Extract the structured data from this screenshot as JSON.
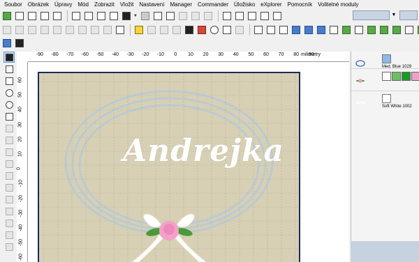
{
  "menu": [
    "Soubor",
    "Obrázek",
    "Úpravy",
    "Mód",
    "Zobrazit",
    "Vložit",
    "Nastavení",
    "Manager",
    "Commander",
    "Úložisko",
    "eXplorer",
    "Pomocník",
    "Volitelné moduly"
  ],
  "ruler": {
    "unit": "milimetry",
    "h_ticks": [
      "-90",
      "-80",
      "-70",
      "-60",
      "-50",
      "-40",
      "-30",
      "-20",
      "-10",
      "0",
      "10",
      "20",
      "30",
      "40",
      "50",
      "60",
      "70",
      "80",
      "90"
    ],
    "v_ticks": [
      "60",
      "50",
      "40",
      "30",
      "20",
      "10",
      "0",
      "-10",
      "-20",
      "-30",
      "-40",
      "-50",
      "-60"
    ]
  },
  "design": {
    "title": "Andrejka",
    "background_color": "#d7d0b4",
    "frame_color": "#1a2a5c",
    "wreath_color": "#a9c6e6",
    "rose_color": "#f4a0c8",
    "leaf_color": "#4a9a3a"
  },
  "threads": [
    {
      "name": "Med. Blue 1029",
      "color": "#8fb8e8"
    },
    {
      "name": "",
      "colors": [
        "#ffffff",
        "#6cc060",
        "#1a9a2a",
        "#f0a0c8"
      ]
    },
    {
      "name": "Soft White 1002",
      "color": "#ffffff"
    }
  ],
  "colors": {
    "panel_bottom": "#c7d2e0",
    "toolbar_combo": "#c9d4e3"
  }
}
